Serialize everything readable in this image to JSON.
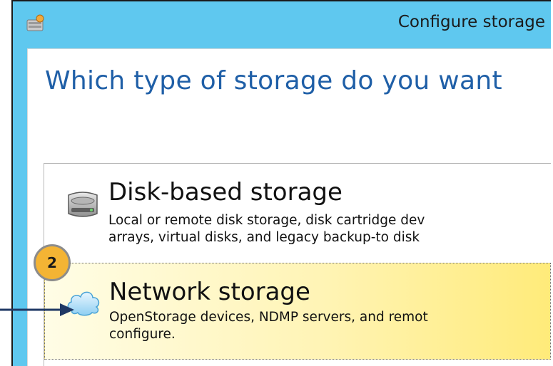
{
  "window": {
    "title": "Configure storage",
    "icon": "storage-config-icon"
  },
  "heading": "Which type of storage do you want",
  "options": [
    {
      "title": "Disk-based storage",
      "desc_lines": [
        "Local or remote disk storage, disk cartridge dev",
        "arrays, virtual disks, and legacy backup-to disk"
      ],
      "icon": "hard-disk-icon",
      "selected": false
    },
    {
      "title": "Network storage",
      "desc_lines": [
        "OpenStorage devices, NDMP servers, and remot",
        "configure."
      ],
      "icon": "cloud-icon",
      "selected": true
    }
  ],
  "annotation": {
    "step": "2",
    "badge_color": "#f4b434",
    "arrow_color": "#1f3864"
  },
  "colors": {
    "titlebar": "#5fc8ef",
    "heading": "#1f5fa7",
    "selected_bg": "#fff4b5"
  }
}
